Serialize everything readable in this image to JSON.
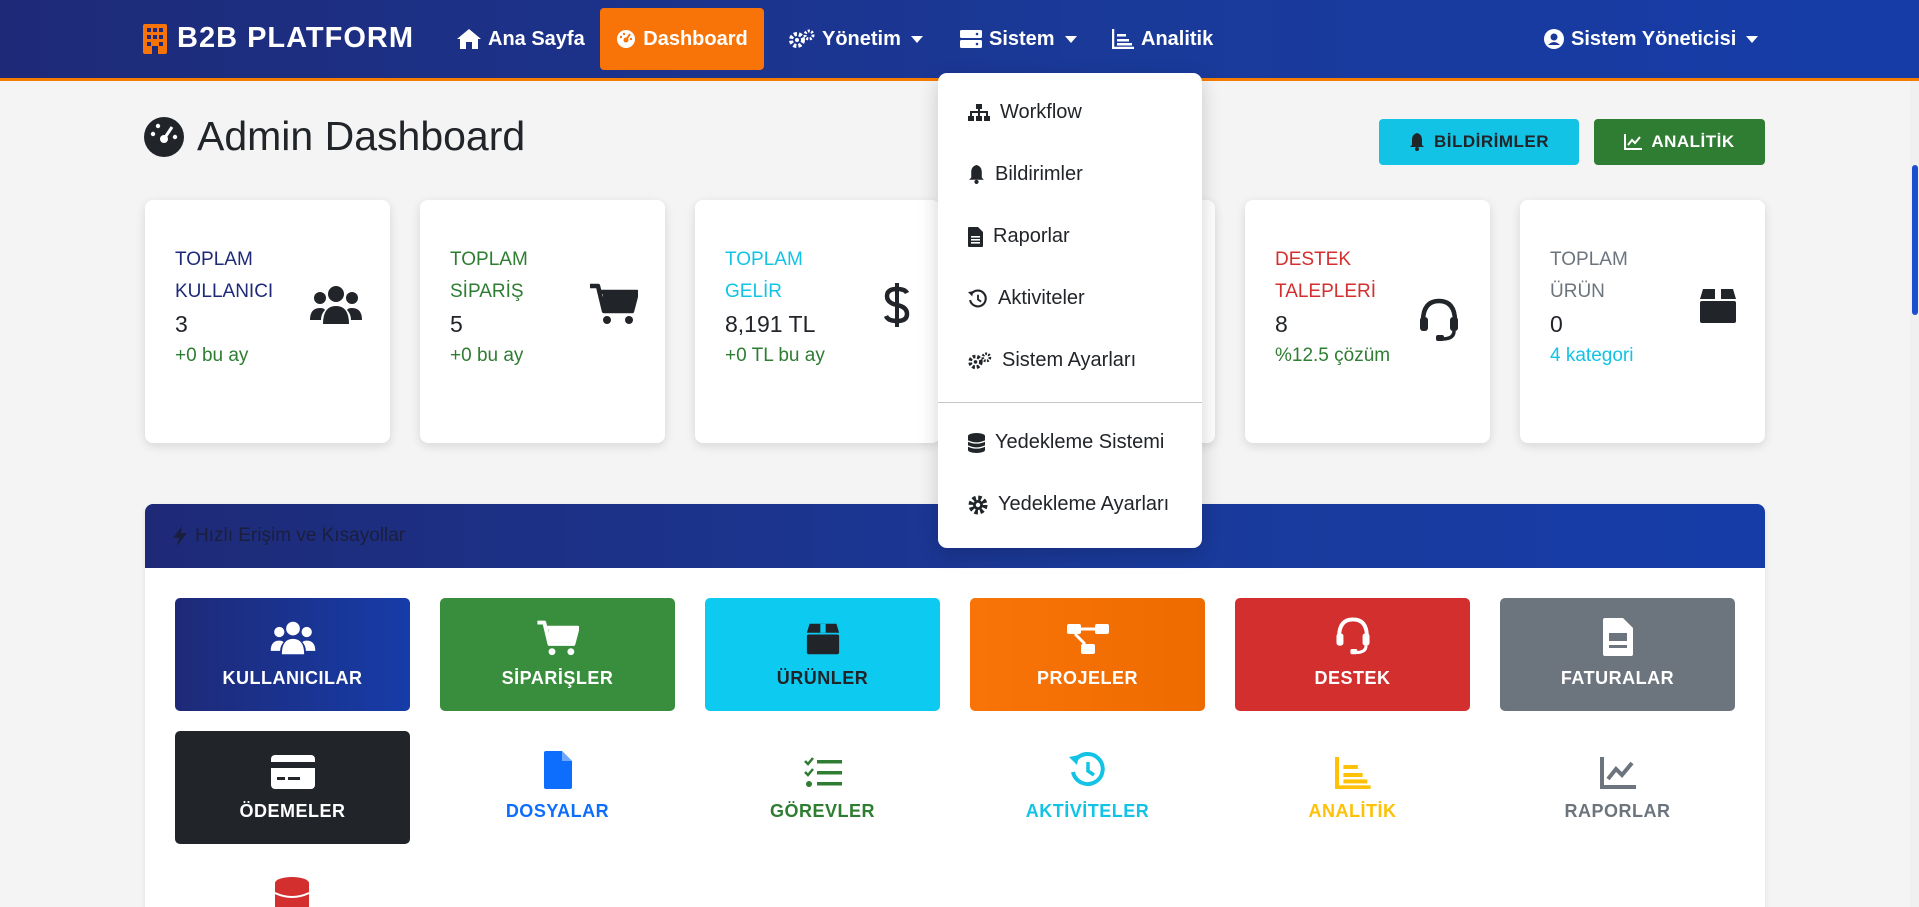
{
  "navbar": {
    "brand": "B2B PLATFORM",
    "items": [
      {
        "label": "Ana Sayfa",
        "icon": "home-icon"
      },
      {
        "label": "Dashboard",
        "icon": "dashboard-icon",
        "active": true
      },
      {
        "label": "Yönetim",
        "icon": "cogs-icon",
        "dropdown": true
      },
      {
        "label": "Sistem",
        "icon": "server-icon",
        "dropdown": true
      },
      {
        "label": "Analitik",
        "icon": "chart-bar-icon"
      }
    ],
    "user": "Sistem Yöneticisi"
  },
  "header": {
    "title": "Admin Dashboard",
    "notifications_button": "BİLDİRİMLER",
    "analytics_button": "ANALİTİK"
  },
  "stats": [
    {
      "label": "TOPLAM KULLANICI",
      "value": "3",
      "sub": "+0 bu ay",
      "icon": "users-icon",
      "label_color": "#1e2a78",
      "sub_color": "#2e7d32"
    },
    {
      "label": "TOPLAM SİPARİŞ",
      "value": "5",
      "sub": "+0 bu ay",
      "icon": "cart-icon",
      "label_color": "#2e7d32",
      "sub_color": "#2e7d32"
    },
    {
      "label": "TOPLAM GELİR",
      "value": "8,191 TL",
      "sub": "+0 TL bu ay",
      "icon": "dollar-icon",
      "label_color": "#12c3e6",
      "sub_color": "#2e7d32"
    },
    {
      "label": "DESTEK TALEPLERİ",
      "value": "8",
      "sub": "%12.5 çözüm",
      "icon": "headset-icon",
      "label_color": "#d32f2f",
      "sub_color": "#2e7d32"
    },
    {
      "label": "TOPLAM ÜRÜN",
      "value": "0",
      "sub": "4 kategori",
      "icon": "box-icon",
      "label_color": "#6c757d",
      "sub_color": "#12c3e6"
    }
  ],
  "quick_access": {
    "title": "Hızlı Erişim ve Kısayollar",
    "tiles": [
      {
        "label": "KULLANICILAR",
        "icon": "users-icon"
      },
      {
        "label": "SİPARİŞLER",
        "icon": "cart-icon"
      },
      {
        "label": "ÜRÜNLER",
        "icon": "box-icon"
      },
      {
        "label": "PROJELER",
        "icon": "project-diagram-icon"
      },
      {
        "label": "DESTEK",
        "icon": "headset-icon"
      },
      {
        "label": "FATURALAR",
        "icon": "invoice-icon"
      },
      {
        "label": "ÖDEMELER",
        "icon": "credit-card-icon"
      },
      {
        "label": "DOSYALAR",
        "icon": "file-icon"
      },
      {
        "label": "GÖREVLER",
        "icon": "tasks-icon"
      },
      {
        "label": "AKTİVİTELER",
        "icon": "history-icon"
      },
      {
        "label": "ANALİTİK",
        "icon": "chart-bar-icon"
      },
      {
        "label": "RAPORLAR",
        "icon": "chart-line-icon"
      }
    ]
  },
  "sistem_dropdown": {
    "items": [
      {
        "label": "Workflow",
        "icon": "sitemap-icon"
      },
      {
        "label": "Bildirimler",
        "icon": "bell-icon"
      },
      {
        "label": "Raporlar",
        "icon": "file-alt-icon"
      },
      {
        "label": "Aktiviteler",
        "icon": "history-icon"
      },
      {
        "label": "Sistem Ayarları",
        "icon": "cogs-icon"
      },
      {
        "label": "Yedekleme Sistemi",
        "icon": "database-icon"
      },
      {
        "label": "Yedekleme Ayarları",
        "icon": "cog-icon"
      }
    ]
  },
  "colors": {
    "navbar": "#1e2a78",
    "accent_orange": "#f97408",
    "info": "#12c3e6",
    "success": "#2e7d32",
    "danger": "#d32f2f",
    "secondary": "#6c757d",
    "dark": "#212529"
  }
}
